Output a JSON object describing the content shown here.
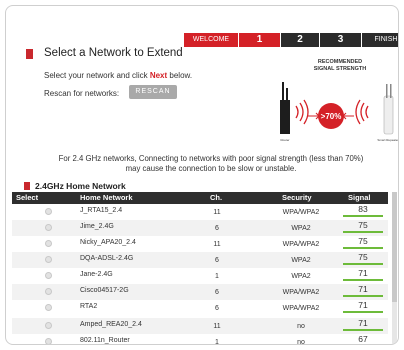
{
  "wizard": {
    "steps": [
      "WELCOME",
      "1",
      "2",
      "3",
      "FINISH"
    ],
    "active_step": "1"
  },
  "page": {
    "title": "Select a Network to Extend",
    "instruction_pre": "Select your network and click ",
    "instruction_next": "Next",
    "instruction_post": " below.",
    "rescan_label": "Rescan for networks:",
    "rescan_button": "RESCAN"
  },
  "strength_graphic": {
    "heading_line1": "RECOMMENDED",
    "heading_line2": "SIGNAL STRENGTH",
    "value": ">70%",
    "left_device_label": "Router",
    "right_device_label": "Smart Repeater",
    "accent_color": "#d42127"
  },
  "warning": {
    "line1": "For 2.4 GHz networks, Connecting to networks with poor signal strength (less than 70%)",
    "line2": "may cause the connection to be slow or unstable."
  },
  "section": {
    "title": "2.4GHz Home Network"
  },
  "table": {
    "headers": [
      "Select",
      "Home Network",
      "Ch.",
      "Security",
      "Signal"
    ],
    "rows": [
      {
        "name": "J_RTA15_2.4",
        "channel": "11",
        "security": "WPA/WPA2",
        "signal": "83"
      },
      {
        "name": "Jime_2.4G",
        "channel": "6",
        "security": "WPA2",
        "signal": "75"
      },
      {
        "name": "Nicky_APA20_2.4",
        "channel": "11",
        "security": "WPA/WPA2",
        "signal": "75"
      },
      {
        "name": "DQA-ADSL-2.4G",
        "channel": "6",
        "security": "WPA2",
        "signal": "75"
      },
      {
        "name": "Jane-2.4G",
        "channel": "1",
        "security": "WPA2",
        "signal": "71"
      },
      {
        "name": "Cisco04517-2G",
        "channel": "6",
        "security": "WPA/WPA2",
        "signal": "71"
      },
      {
        "name": "RTA2",
        "channel": "6",
        "security": "WPA/WPA2",
        "signal": "71"
      },
      {
        "name": "Amped_REA20_2.4",
        "channel": "11",
        "security": "no",
        "signal": "71"
      },
      {
        "name": "802.11n_Router",
        "channel": "1",
        "security": "no",
        "signal": "67"
      }
    ]
  },
  "colors": {
    "brand_red": "#d42127",
    "signal_green": "#6dbb3a",
    "header_dark": "#2e2e2e"
  }
}
